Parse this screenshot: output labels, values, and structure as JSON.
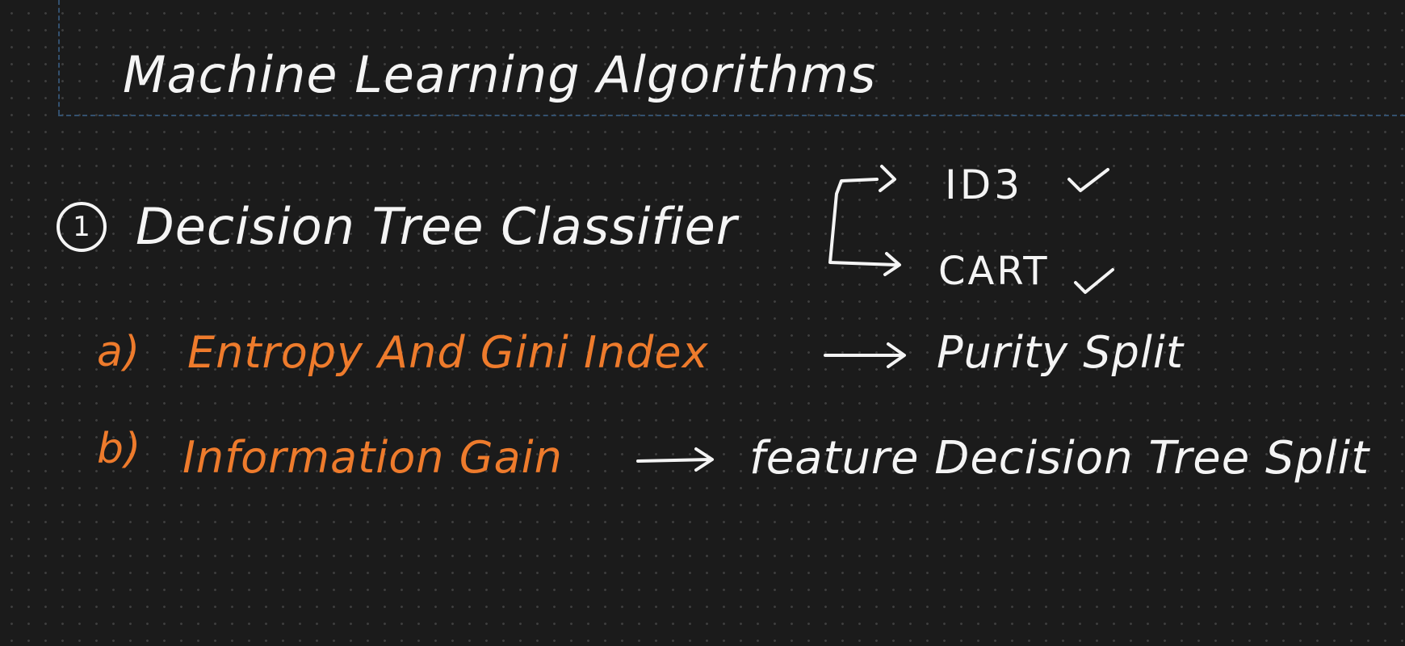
{
  "canvas": {
    "background": "#1b1b1b",
    "grid_dot_color": "#3e3e3e",
    "guide_color": "#33506e",
    "ink_white": "#f4f4f4",
    "ink_orange": "#ee7b2c"
  },
  "notes": {
    "title": "Machine Learning Algorithms",
    "item_number": "1",
    "item_title": "Decision Tree Classifier",
    "branches": [
      {
        "label": "ID3",
        "mark": "check-icon"
      },
      {
        "label": "CART",
        "mark": "check-icon"
      }
    ],
    "sub_items": [
      {
        "marker": "a)",
        "text": "Entropy And Gini Index",
        "result": "Purity Split"
      },
      {
        "marker": "b)",
        "text": "Information Gain",
        "result": "feature Decision Tree Split"
      }
    ]
  }
}
